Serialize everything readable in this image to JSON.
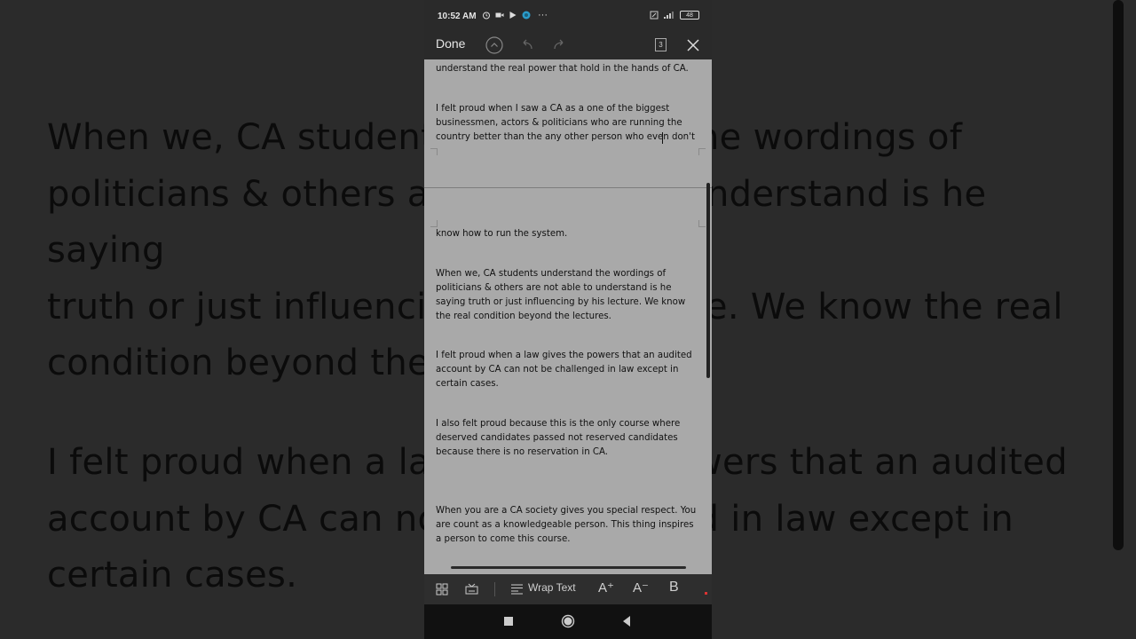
{
  "background": {
    "paragraph1": [
      "When we, CA students understand the wordings of",
      "politicians & others are not able to understand is he saying",
      "truth or just influencing by his lecture. We know the real",
      "condition beyond the lectures."
    ],
    "paragraph2": [
      "I felt proud when a law gives the powers that an audited",
      "account by CA can not be challenged in law except in",
      "certain cases."
    ]
  },
  "status_bar": {
    "time": "10:52 AM",
    "battery": "48",
    "more": "···"
  },
  "toolbar": {
    "done_label": "Done",
    "page_count": "3"
  },
  "document": {
    "top_fragment": "understand the real power that hold in the hands of CA.",
    "para_biggest": "I felt proud when I saw a CA as a one of the biggest businessmen, actors & politicians who are running the country better than the any other person who even don't",
    "para_system": "know how to run the system.",
    "para_wordings": "When we, CA students understand the wordings of politicians & others are not able to understand is he saying truth or just influencing by his lecture. We know the real condition beyond the lectures.",
    "para_law": "I felt proud when a law gives the powers that an audited account by CA can not be challenged in law except in certain cases.",
    "para_course": "I also felt proud because this is the only course where deserved candidates passed not reserved candidates because there is no reservation in CA.",
    "para_society": "When you are a CA society gives you special respect. You are count as a knowledgeable person. This thing inspires a person to come this course."
  },
  "format_bar": {
    "wrap_text": "Wrap Text",
    "increase_font": "A⁺",
    "decrease_font": "A⁻",
    "bold": "B"
  },
  "colors": {
    "page_bg": "#a9a9a9",
    "toolbar_bg": "#2a2a2a",
    "text": "#111111"
  }
}
